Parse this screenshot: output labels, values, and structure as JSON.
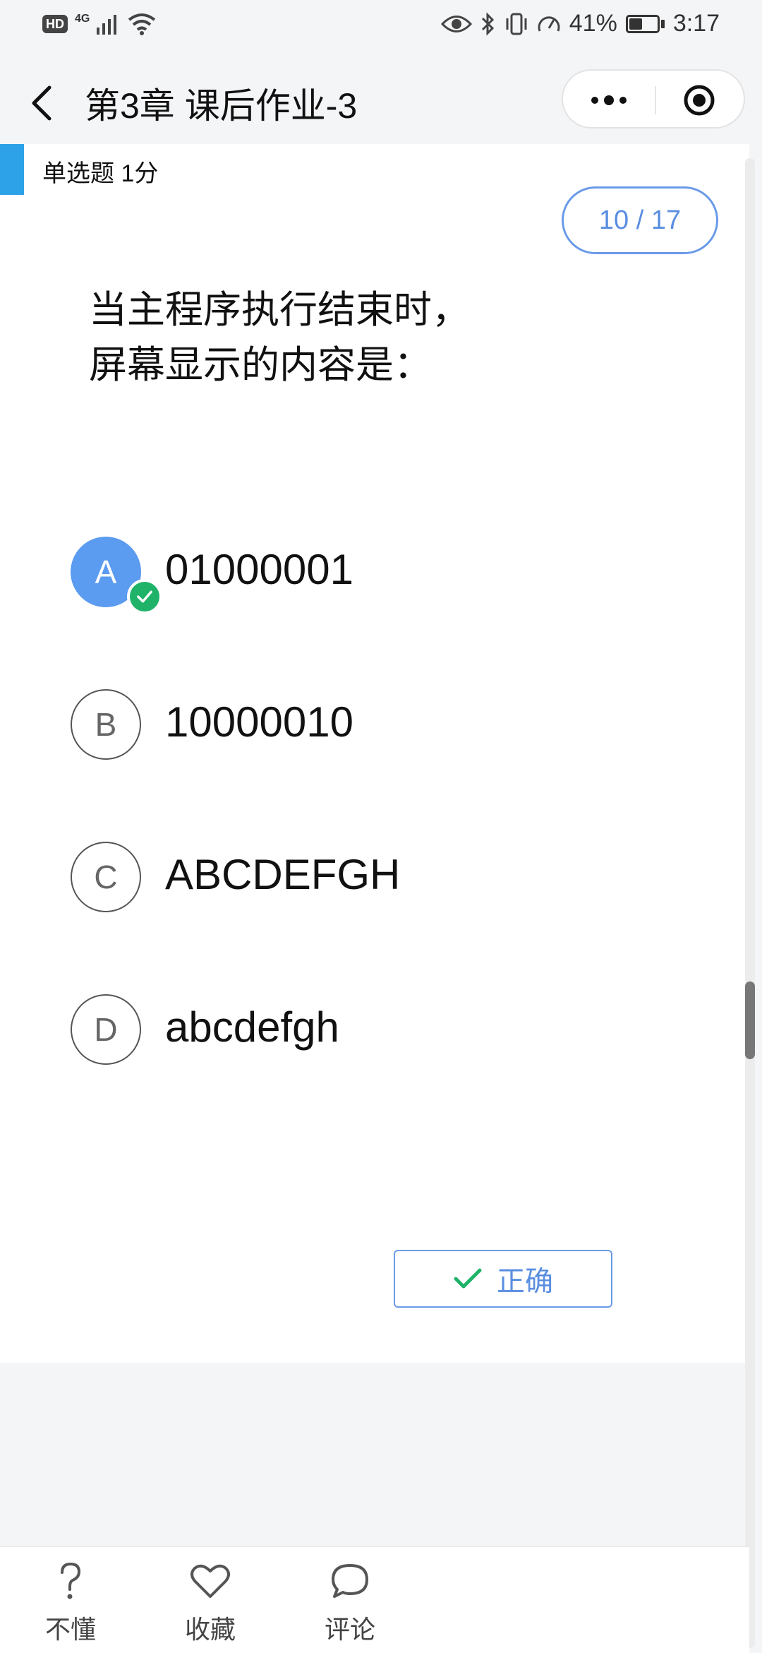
{
  "status_bar": {
    "hd": "HD",
    "network": "4G",
    "battery": "41%",
    "time": "3:17",
    "icons": [
      "signal-icon",
      "wifi-icon",
      "eye-icon",
      "bluetooth-icon",
      "vibrate-icon",
      "speed-icon",
      "battery-icon"
    ]
  },
  "nav": {
    "title": "第3章 课后作业-3",
    "back_icon": "back-arrow-icon",
    "more_icon": "more-dots-icon",
    "close_icon": "target-circle-icon"
  },
  "question": {
    "type_label": "单选题 1分",
    "counter": "10 / 17",
    "text_line1": "当主程序执行结束时，",
    "text_line2": "屏幕显示的内容是：",
    "options": [
      {
        "letter": "A",
        "text": "01000001",
        "selected": true
      },
      {
        "letter": "B",
        "text": "10000010",
        "selected": false
      },
      {
        "letter": "C",
        "text": "ABCDEFGH",
        "selected": false
      },
      {
        "letter": "D",
        "text": "abcdefgh",
        "selected": false
      }
    ],
    "result_label": "正确"
  },
  "bottom_tabs": [
    {
      "label": "不懂",
      "icon": "question-mark-icon"
    },
    {
      "label": "收藏",
      "icon": "heart-icon"
    },
    {
      "label": "评论",
      "icon": "comment-bubble-icon"
    }
  ],
  "colors": {
    "accent_blue": "#2ea2e8",
    "selected_option": "#5b9bf0",
    "correct_green": "#1fb36a",
    "link_blue": "#5a8ee0"
  }
}
